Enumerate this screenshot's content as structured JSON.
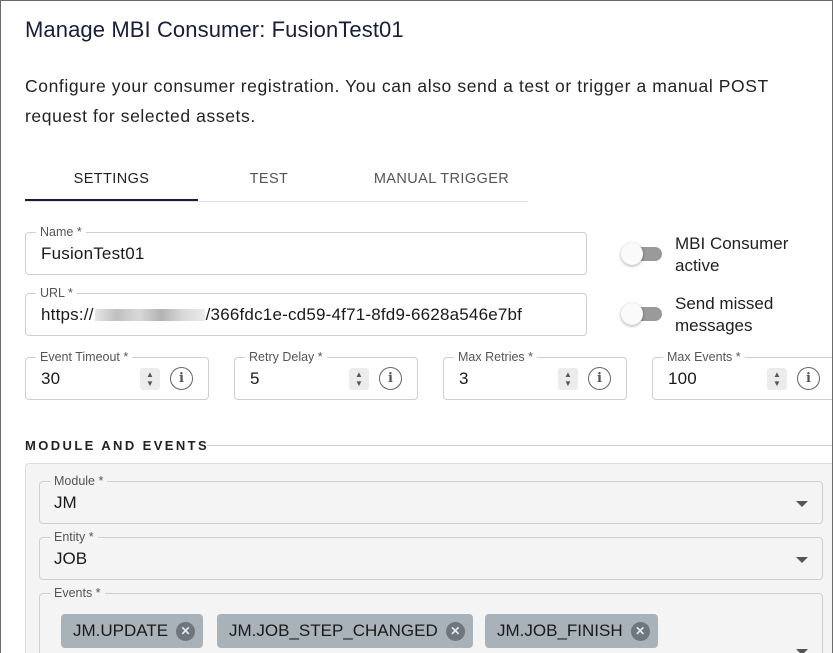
{
  "header": {
    "title": "Manage MBI Consumer: FusionTest01",
    "description": "Configure your consumer registration. You can also send a test or trigger a manual POST request for selected assets."
  },
  "tabs": [
    {
      "label": "SETTINGS",
      "active": true
    },
    {
      "label": "TEST",
      "active": false
    },
    {
      "label": "MANUAL TRIGGER",
      "active": false
    }
  ],
  "settings": {
    "name": {
      "label": "Name *",
      "value": "FusionTest01"
    },
    "url": {
      "label": "URL *",
      "value_prefix": "https://",
      "value_suffix": "/366fdc1e-cd59-4f71-8fd9-6628a546e7bf"
    },
    "toggles": [
      {
        "label": "MBI Consumer active",
        "on": false
      },
      {
        "label": "Send missed messages",
        "on": false
      }
    ],
    "numbers": [
      {
        "label": "Event Timeout *",
        "value": "30"
      },
      {
        "label": "Retry Delay *",
        "value": "5"
      },
      {
        "label": "Max Retries *",
        "value": "3"
      },
      {
        "label": "Max Events *",
        "value": "100"
      }
    ]
  },
  "module_events": {
    "heading": "MODULE AND EVENTS",
    "module": {
      "label": "Module *",
      "value": "JM"
    },
    "entity": {
      "label": "Entity *",
      "value": "JOB"
    },
    "events": {
      "label": "Events *",
      "chips": [
        "JM.UPDATE",
        "JM.JOB_STEP_CHANGED",
        "JM.JOB_FINISH"
      ]
    }
  },
  "icons": {
    "info": "info-icon",
    "stepper": "stepper-arrows-icon",
    "chip_remove": "close-circle-icon",
    "dropdown": "chevron-down-icon"
  },
  "colors": {
    "title": "#1a1d3a",
    "tab_indicator": "#1a1d3a",
    "chip_bg": "#a9b1b9",
    "panel_bg": "#f4f4f4"
  }
}
